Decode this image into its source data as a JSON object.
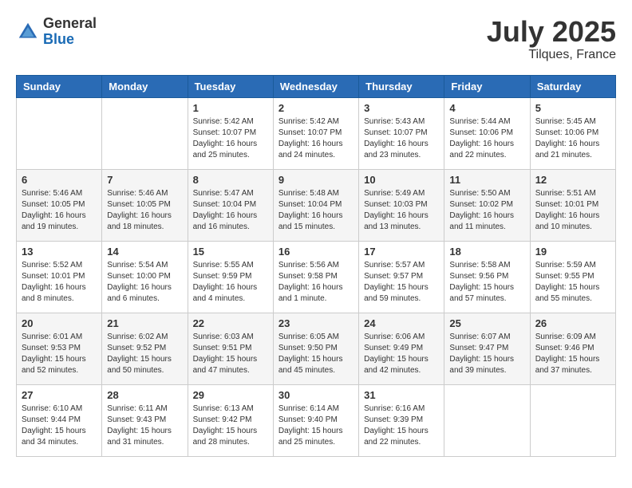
{
  "logo": {
    "general": "General",
    "blue": "Blue"
  },
  "title": {
    "month_year": "July 2025",
    "location": "Tilques, France"
  },
  "headers": [
    "Sunday",
    "Monday",
    "Tuesday",
    "Wednesday",
    "Thursday",
    "Friday",
    "Saturday"
  ],
  "weeks": [
    [
      {
        "day": "",
        "info": ""
      },
      {
        "day": "",
        "info": ""
      },
      {
        "day": "1",
        "info": "Sunrise: 5:42 AM\nSunset: 10:07 PM\nDaylight: 16 hours\nand 25 minutes."
      },
      {
        "day": "2",
        "info": "Sunrise: 5:42 AM\nSunset: 10:07 PM\nDaylight: 16 hours\nand 24 minutes."
      },
      {
        "day": "3",
        "info": "Sunrise: 5:43 AM\nSunset: 10:07 PM\nDaylight: 16 hours\nand 23 minutes."
      },
      {
        "day": "4",
        "info": "Sunrise: 5:44 AM\nSunset: 10:06 PM\nDaylight: 16 hours\nand 22 minutes."
      },
      {
        "day": "5",
        "info": "Sunrise: 5:45 AM\nSunset: 10:06 PM\nDaylight: 16 hours\nand 21 minutes."
      }
    ],
    [
      {
        "day": "6",
        "info": "Sunrise: 5:46 AM\nSunset: 10:05 PM\nDaylight: 16 hours\nand 19 minutes."
      },
      {
        "day": "7",
        "info": "Sunrise: 5:46 AM\nSunset: 10:05 PM\nDaylight: 16 hours\nand 18 minutes."
      },
      {
        "day": "8",
        "info": "Sunrise: 5:47 AM\nSunset: 10:04 PM\nDaylight: 16 hours\nand 16 minutes."
      },
      {
        "day": "9",
        "info": "Sunrise: 5:48 AM\nSunset: 10:04 PM\nDaylight: 16 hours\nand 15 minutes."
      },
      {
        "day": "10",
        "info": "Sunrise: 5:49 AM\nSunset: 10:03 PM\nDaylight: 16 hours\nand 13 minutes."
      },
      {
        "day": "11",
        "info": "Sunrise: 5:50 AM\nSunset: 10:02 PM\nDaylight: 16 hours\nand 11 minutes."
      },
      {
        "day": "12",
        "info": "Sunrise: 5:51 AM\nSunset: 10:01 PM\nDaylight: 16 hours\nand 10 minutes."
      }
    ],
    [
      {
        "day": "13",
        "info": "Sunrise: 5:52 AM\nSunset: 10:01 PM\nDaylight: 16 hours\nand 8 minutes."
      },
      {
        "day": "14",
        "info": "Sunrise: 5:54 AM\nSunset: 10:00 PM\nDaylight: 16 hours\nand 6 minutes."
      },
      {
        "day": "15",
        "info": "Sunrise: 5:55 AM\nSunset: 9:59 PM\nDaylight: 16 hours\nand 4 minutes."
      },
      {
        "day": "16",
        "info": "Sunrise: 5:56 AM\nSunset: 9:58 PM\nDaylight: 16 hours\nand 1 minute."
      },
      {
        "day": "17",
        "info": "Sunrise: 5:57 AM\nSunset: 9:57 PM\nDaylight: 15 hours\nand 59 minutes."
      },
      {
        "day": "18",
        "info": "Sunrise: 5:58 AM\nSunset: 9:56 PM\nDaylight: 15 hours\nand 57 minutes."
      },
      {
        "day": "19",
        "info": "Sunrise: 5:59 AM\nSunset: 9:55 PM\nDaylight: 15 hours\nand 55 minutes."
      }
    ],
    [
      {
        "day": "20",
        "info": "Sunrise: 6:01 AM\nSunset: 9:53 PM\nDaylight: 15 hours\nand 52 minutes."
      },
      {
        "day": "21",
        "info": "Sunrise: 6:02 AM\nSunset: 9:52 PM\nDaylight: 15 hours\nand 50 minutes."
      },
      {
        "day": "22",
        "info": "Sunrise: 6:03 AM\nSunset: 9:51 PM\nDaylight: 15 hours\nand 47 minutes."
      },
      {
        "day": "23",
        "info": "Sunrise: 6:05 AM\nSunset: 9:50 PM\nDaylight: 15 hours\nand 45 minutes."
      },
      {
        "day": "24",
        "info": "Sunrise: 6:06 AM\nSunset: 9:49 PM\nDaylight: 15 hours\nand 42 minutes."
      },
      {
        "day": "25",
        "info": "Sunrise: 6:07 AM\nSunset: 9:47 PM\nDaylight: 15 hours\nand 39 minutes."
      },
      {
        "day": "26",
        "info": "Sunrise: 6:09 AM\nSunset: 9:46 PM\nDaylight: 15 hours\nand 37 minutes."
      }
    ],
    [
      {
        "day": "27",
        "info": "Sunrise: 6:10 AM\nSunset: 9:44 PM\nDaylight: 15 hours\nand 34 minutes."
      },
      {
        "day": "28",
        "info": "Sunrise: 6:11 AM\nSunset: 9:43 PM\nDaylight: 15 hours\nand 31 minutes."
      },
      {
        "day": "29",
        "info": "Sunrise: 6:13 AM\nSunset: 9:42 PM\nDaylight: 15 hours\nand 28 minutes."
      },
      {
        "day": "30",
        "info": "Sunrise: 6:14 AM\nSunset: 9:40 PM\nDaylight: 15 hours\nand 25 minutes."
      },
      {
        "day": "31",
        "info": "Sunrise: 6:16 AM\nSunset: 9:39 PM\nDaylight: 15 hours\nand 22 minutes."
      },
      {
        "day": "",
        "info": ""
      },
      {
        "day": "",
        "info": ""
      }
    ]
  ]
}
